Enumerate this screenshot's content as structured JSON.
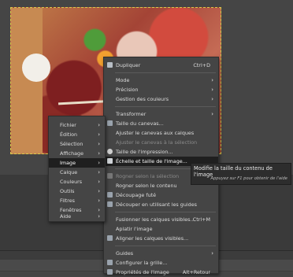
{
  "main_menu": {
    "items": [
      {
        "label": "Dupliquer",
        "shortcut": "Ctrl+D"
      },
      {
        "label": "Mode"
      },
      {
        "label": "Précision"
      },
      {
        "label": "Gestion des couleurs"
      },
      {
        "label": "Transformer"
      },
      {
        "label": "Taille du canevas..."
      },
      {
        "label": "Ajuster le canevas aux calques"
      },
      {
        "label": "Ajuster le canevas à la sélection"
      },
      {
        "label": "Taille de l'impression..."
      },
      {
        "label": "Échelle et taille de l'image..."
      },
      {
        "label": "Rogner selon la sélection"
      },
      {
        "label": "Rogner selon le contenu"
      },
      {
        "label": "Découpage futé"
      },
      {
        "label": "Découper en utilisant les guides"
      },
      {
        "label": "Fusionner les calques visibles...",
        "shortcut": "Ctrl+M"
      },
      {
        "label": "Aplatir l'image"
      },
      {
        "label": "Aligner les calques visibles..."
      },
      {
        "label": "Guides"
      },
      {
        "label": "Configurer la grille..."
      },
      {
        "label": "Propriétés de l'image",
        "shortcut": "Alt+Retour"
      }
    ]
  },
  "sub_menu": {
    "items": [
      {
        "label": "Fichier"
      },
      {
        "label": "Édition"
      },
      {
        "label": "Sélection"
      },
      {
        "label": "Affichage"
      },
      {
        "label": "Image"
      },
      {
        "label": "Calque"
      },
      {
        "label": "Couleurs"
      },
      {
        "label": "Outils"
      },
      {
        "label": "Filtres"
      },
      {
        "label": "Fenêtres"
      },
      {
        "label": "Aide"
      }
    ]
  },
  "tooltip": {
    "title": "Modifie la taille du contenu de l'image",
    "hint": "Appuyez sur F1 pour obtenir de l'aide"
  }
}
